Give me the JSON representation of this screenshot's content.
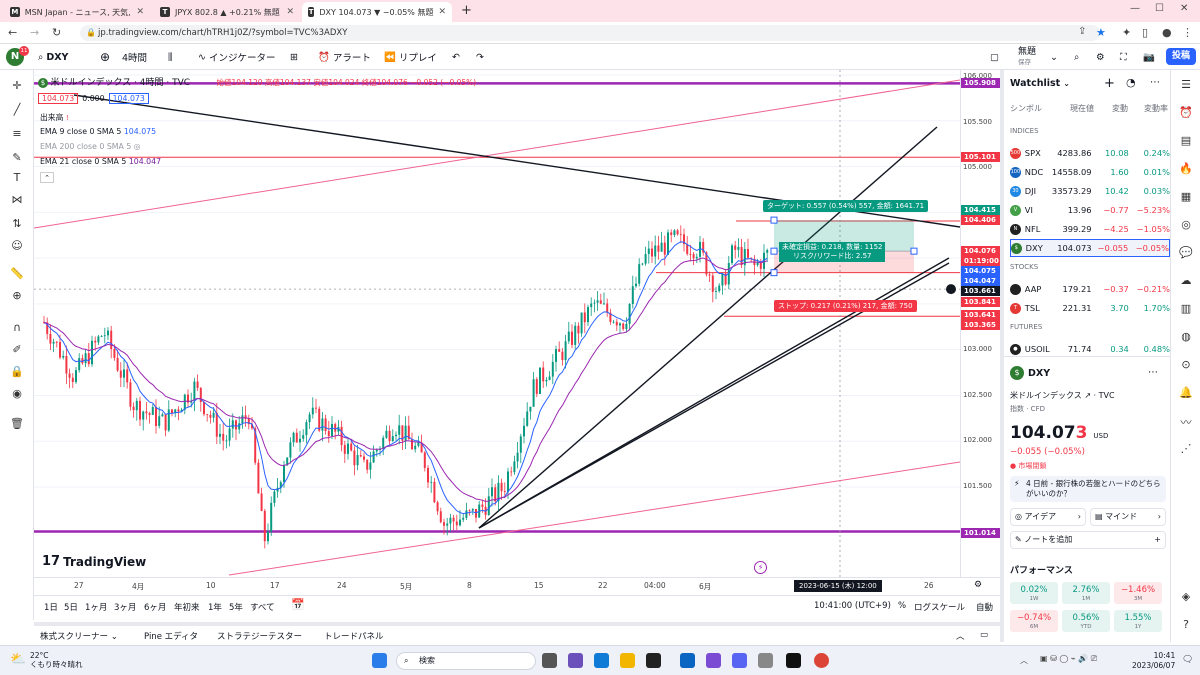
{
  "browser": {
    "tabs": [
      {
        "title": "MSN Japan - ニュース, 天気, メール・",
        "active": false
      },
      {
        "title": "JPYX 802.8 ▲ +0.21% 無題",
        "active": false
      },
      {
        "title": "DXY 104.073 ▼ −0.05% 無題",
        "active": true
      }
    ],
    "url": "jp.tradingview.com/chart/hTRH1j0Z/?symbol=TVC%3ADXY"
  },
  "toolbar": {
    "symbol": "DXY",
    "interval": "4時間",
    "indicators": "インジケーター",
    "alert": "アラート",
    "replay": "リプレイ",
    "layout_name": "無題",
    "layout_sub": "保存",
    "publish": "投稿",
    "profile_badge": "11"
  },
  "legend": {
    "title": "米ドルインデックス · 4時間 · TVC",
    "ohlc": "始値104.120 高値104.137 安値104.024 終値104.076 −0.052 (−0.05%)",
    "bid": "104.073",
    "spread": "0.000",
    "ask": "104.073",
    "volume": "出来高",
    "ema9": "EMA 9 close 0 SMA 5",
    "ema9_val": "104.075",
    "ema200": "EMA 200 close 0 SMA 5",
    "ema21": "EMA 21 close 0 SMA 5",
    "ema21_val": "104.047"
  },
  "position": {
    "target": "ターゲット: 0.557 (0.54%) 557, 金額: 1641.71",
    "pnl": "未確定損益: 0.218, 数量: 1152",
    "rr": "リスク/リワード比: 2.57",
    "stop": "ストップ: 0.217 (0.21%) 217, 金額: 750"
  },
  "price_axis": {
    "ticks": [
      "106.000",
      "105.500",
      "105.000",
      "104.500",
      "104.000",
      "103.500",
      "103.000",
      "102.500",
      "102.000",
      "101.500"
    ],
    "badges": [
      {
        "text": "105.908",
        "color": "#9c27b0"
      },
      {
        "text": "105.101",
        "color": "#f23645"
      },
      {
        "text": "104.415",
        "color": "#089981"
      },
      {
        "text": "104.406",
        "color": "#f23645"
      },
      {
        "text": "104.076",
        "color": "#f23645"
      },
      {
        "text": "01:19:00",
        "color": "#f23645"
      },
      {
        "text": "104.075",
        "color": "#2962ff"
      },
      {
        "text": "104.047",
        "color": "#2962ff"
      },
      {
        "text": "103.661",
        "color": "#131722"
      },
      {
        "text": "103.841",
        "color": "#f23645"
      },
      {
        "text": "103.641",
        "color": "#f23645"
      },
      {
        "text": "103.365",
        "color": "#f23645"
      },
      {
        "text": "101.014",
        "color": "#9c27b0"
      }
    ]
  },
  "time_axis": {
    "labels": [
      "27",
      "4月",
      "10",
      "17",
      "24",
      "5月",
      "8",
      "15",
      "22",
      "04:00",
      "6月",
      "",
      "26"
    ],
    "crosshair": "2023-06-15 (木)  12:00"
  },
  "range_bar": {
    "ranges": [
      "1日",
      "5日",
      "1ヶ月",
      "3ヶ月",
      "6ヶ月",
      "年初来",
      "1年",
      "5年",
      "すべて"
    ],
    "clock": "10:41:00 (UTC+9)",
    "pct": "%",
    "log": "ログスケール",
    "auto": "自動"
  },
  "bottom_tabs": [
    "株式スクリーナー",
    "Pine エディタ",
    "ストラテジーテスター",
    "トレードパネル"
  ],
  "watchlist": {
    "title": "Watchlist",
    "headers": [
      "シンボル",
      "現在値",
      "変動",
      "変動率"
    ],
    "sections": [
      {
        "name": "INDICES",
        "rows": [
          {
            "sym": "SPX",
            "last": "4283.86",
            "chg": "10.08",
            "pct": "0.24%",
            "dir": "pos",
            "color": "#e53935",
            "ico": "500"
          },
          {
            "sym": "NDC",
            "last": "14558.09",
            "chg": "1.60",
            "pct": "0.01%",
            "dir": "pos",
            "color": "#1565c0",
            "ico": "100"
          },
          {
            "sym": "DJI",
            "last": "33573.29",
            "chg": "10.42",
            "pct": "0.03%",
            "dir": "pos",
            "color": "#1e88e5",
            "ico": "30"
          },
          {
            "sym": "VI",
            "last": "13.96",
            "chg": "−0.77",
            "pct": "−5.23%",
            "dir": "neg",
            "color": "#43a047",
            "ico": "V"
          },
          {
            "sym": "NFL",
            "last": "399.29",
            "chg": "−4.25",
            "pct": "−1.05%",
            "dir": "neg",
            "color": "#212121",
            "ico": "N"
          },
          {
            "sym": "DXY",
            "last": "104.073",
            "chg": "−0.055",
            "pct": "−0.05%",
            "dir": "neg",
            "color": "#2e7d32",
            "ico": "$"
          }
        ]
      },
      {
        "name": "STOCKS",
        "rows": [
          {
            "sym": "AAP",
            "last": "179.21",
            "chg": "−0.37",
            "pct": "−0.21%",
            "dir": "neg",
            "color": "#212121",
            "ico": ""
          },
          {
            "sym": "TSL",
            "last": "221.31",
            "chg": "3.70",
            "pct": "1.70%",
            "dir": "pos",
            "color": "#e53935",
            "ico": "T"
          }
        ]
      },
      {
        "name": "FUTURES",
        "rows": [
          {
            "sym": "USOIL",
            "last": "71.74",
            "chg": "0.34",
            "pct": "0.48%",
            "dir": "pos",
            "color": "#212121",
            "ico": "●"
          }
        ]
      }
    ]
  },
  "detail": {
    "symbol": "DXY",
    "name": "米ドルインデックス",
    "exchange": "TVC",
    "type": "指数 · CFD",
    "price_main": "104.07",
    "price_last": "3",
    "currency": "USD",
    "change": "−0.055 (−0.05%)",
    "status": "● 市場閉鎖",
    "news": "4 日前 - 銀行株の若盤とハードのどちらがいいのか？",
    "idea": "アイデア",
    "mind": "マインド",
    "note": "ノートを追加",
    "perf_title": "パフォーマンス",
    "perf": [
      {
        "val": "0.02%",
        "label": "1W",
        "dir": "pos"
      },
      {
        "val": "2.76%",
        "label": "1M",
        "dir": "pos"
      },
      {
        "val": "−1.46%",
        "label": "3M",
        "dir": "neg"
      },
      {
        "val": "−0.74%",
        "label": "6M",
        "dir": "neg"
      },
      {
        "val": "0.56%",
        "label": "YTD",
        "dir": "pos"
      },
      {
        "val": "1.55%",
        "label": "1Y",
        "dir": "pos"
      }
    ]
  },
  "taskbar": {
    "temp": "22°C",
    "weather": "くもり時々晴れ",
    "search": "検索",
    "time": "10:41",
    "date": "2023/06/07"
  },
  "brand": "TradingView",
  "colors": {
    "up": "#089981",
    "down": "#f23645",
    "accent": "#2962ff",
    "purple": "#9c27b0"
  }
}
